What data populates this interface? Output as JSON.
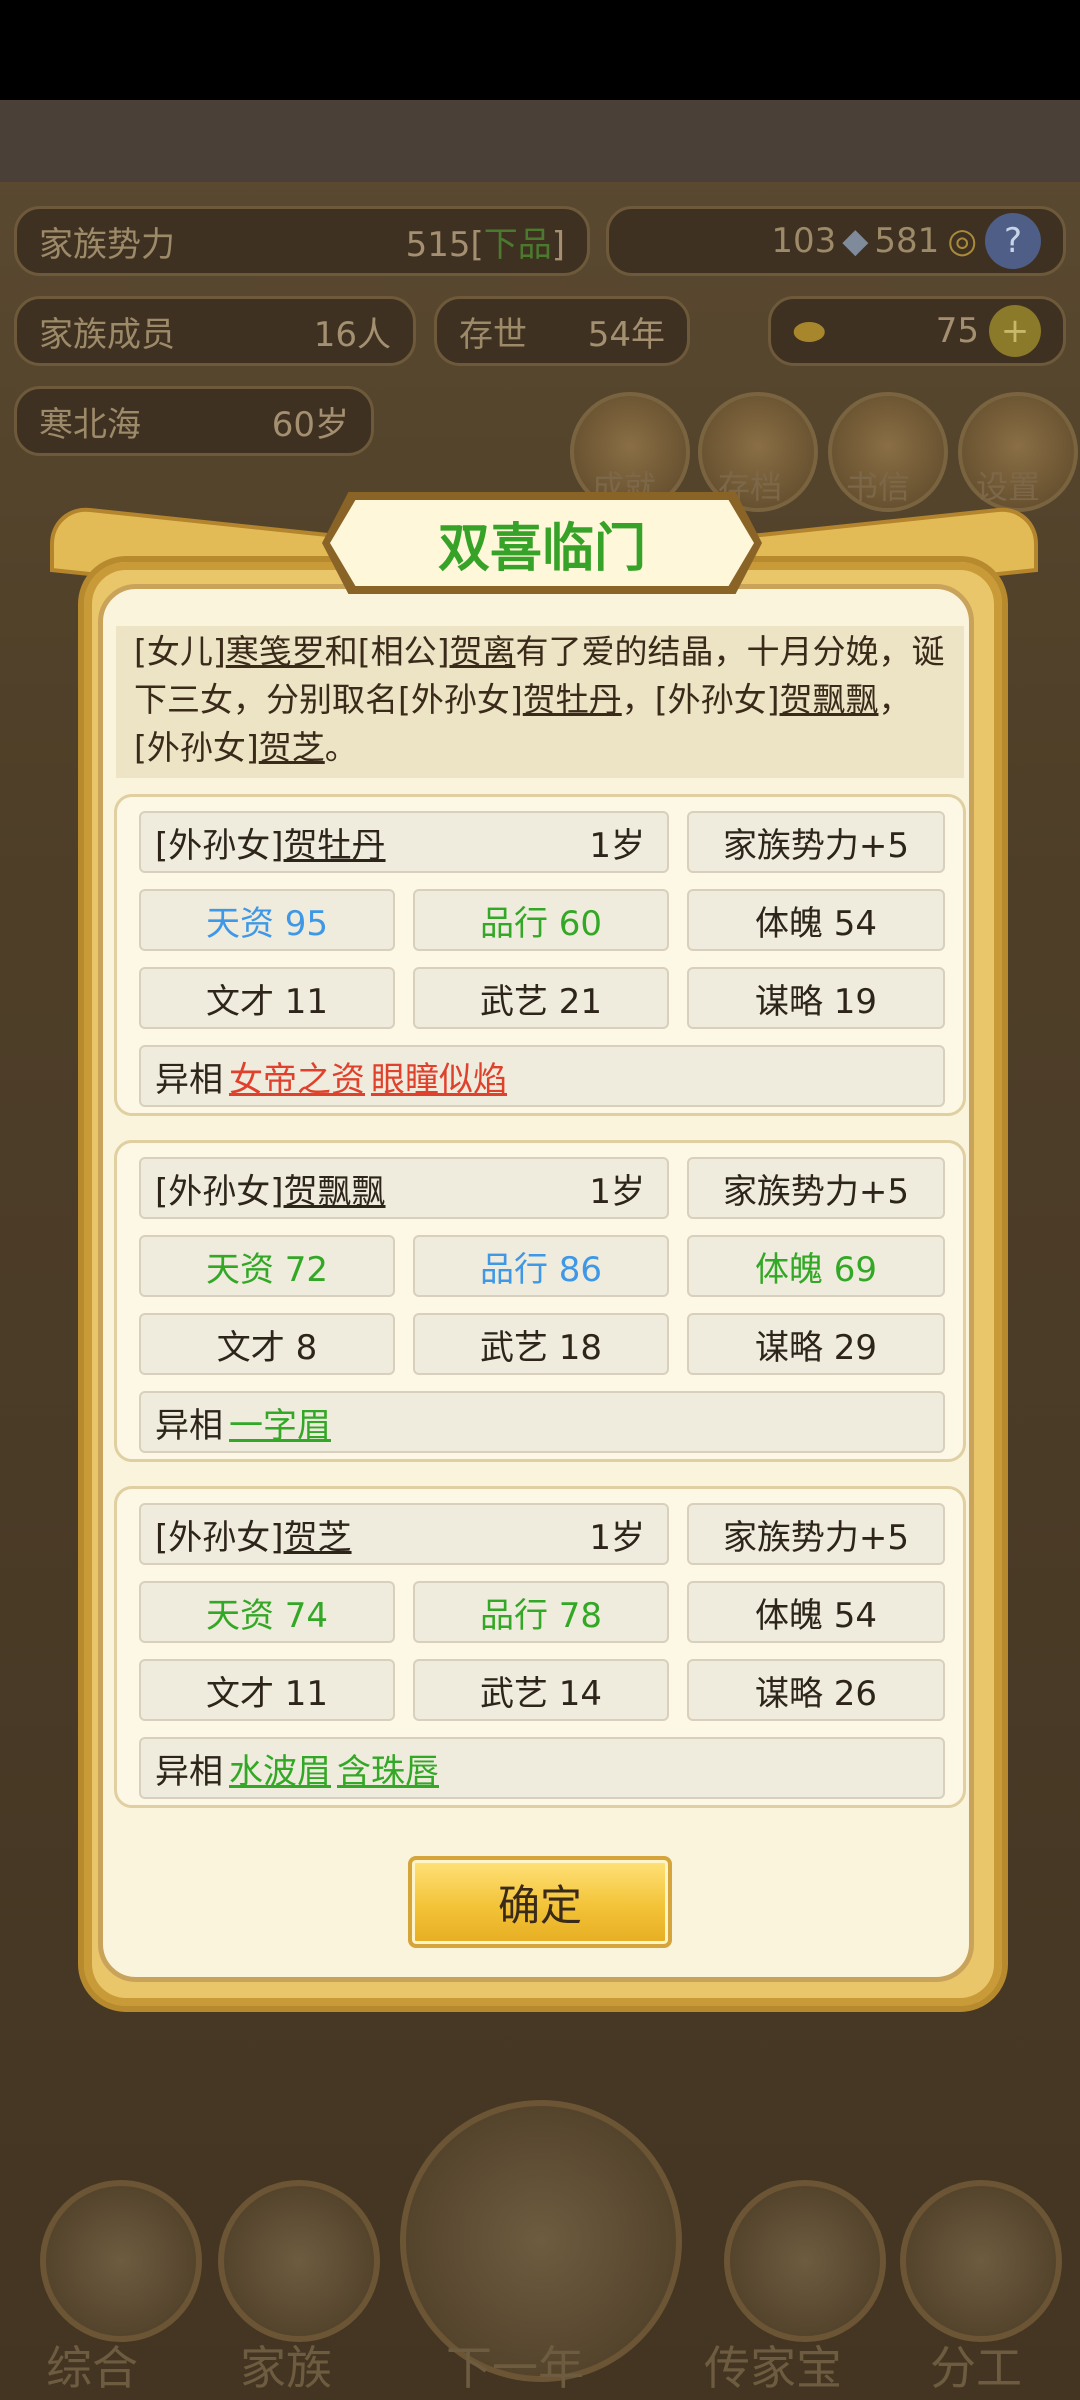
{
  "hud": {
    "power_label": "家族势力",
    "power_value": "515[",
    "power_rank": "下品",
    "power_close": "]",
    "silver": "103",
    "copper": "581",
    "help": "?",
    "members_label": "家族成员",
    "members_value": "16人",
    "exist_label": "存世",
    "exist_value": "54年",
    "gold": "75",
    "plus": "+",
    "patriarch_name": "寒北海",
    "patriarch_age": "60岁",
    "btn_achievement": "成就",
    "btn_save": "存档",
    "btn_letter": "书信",
    "btn_settings": "设置"
  },
  "bottom_nav": {
    "overview": "综合",
    "family": "家族",
    "next_year": "下一年",
    "heirloom": "传家宝",
    "assign": "分工"
  },
  "dialog": {
    "title": "双喜临门",
    "story": {
      "p1": "[女儿]",
      "n1": "寒笺罗",
      "p2": "和[相公]",
      "n2": "贺离",
      "p3": "有了爱的结晶，十月分娩，诞下三女，分别取名[外孙女]",
      "n3": "贺牡丹",
      "p4": "，[外孙女]",
      "n4": "贺飘飘",
      "p5": "，[外孙女]",
      "n5": "贺芝",
      "p6": "。"
    },
    "children": [
      {
        "prefix": "[外孙女]",
        "name": "贺牡丹",
        "age": "1岁",
        "power": "家族势力+5",
        "talent": "天资 95",
        "virtue": "品行 60",
        "physique": "体魄 54",
        "literary": "文才 11",
        "martial": "武艺 21",
        "strategy": "谋略 19",
        "trait_label": "异相",
        "traits": [
          "女帝之资",
          "眼瞳似焰"
        ]
      },
      {
        "prefix": "[外孙女]",
        "name": "贺飘飘",
        "age": "1岁",
        "power": "家族势力+5",
        "talent": "天资 72",
        "virtue": "品行 86",
        "physique": "体魄 69",
        "literary": "文才 8",
        "martial": "武艺 18",
        "strategy": "谋略 29",
        "trait_label": "异相",
        "traits": [
          "一字眉"
        ]
      },
      {
        "prefix": "[外孙女]",
        "name": "贺芝",
        "age": "1岁",
        "power": "家族势力+5",
        "talent": "天资 74",
        "virtue": "品行 78",
        "physique": "体魄 54",
        "literary": "文才 11",
        "martial": "武艺 14",
        "strategy": "谋略 26",
        "trait_label": "异相",
        "traits": [
          "水波眉",
          "含珠唇"
        ]
      }
    ],
    "confirm": "确定"
  },
  "colors": {
    "title_green": "#37a228",
    "stat_blue": "#3e98e6",
    "stat_green": "#33a826",
    "trait_red": "#e0412d",
    "dialog_gold": "#e9c66a",
    "dialog_paper": "#fbf4dc"
  }
}
